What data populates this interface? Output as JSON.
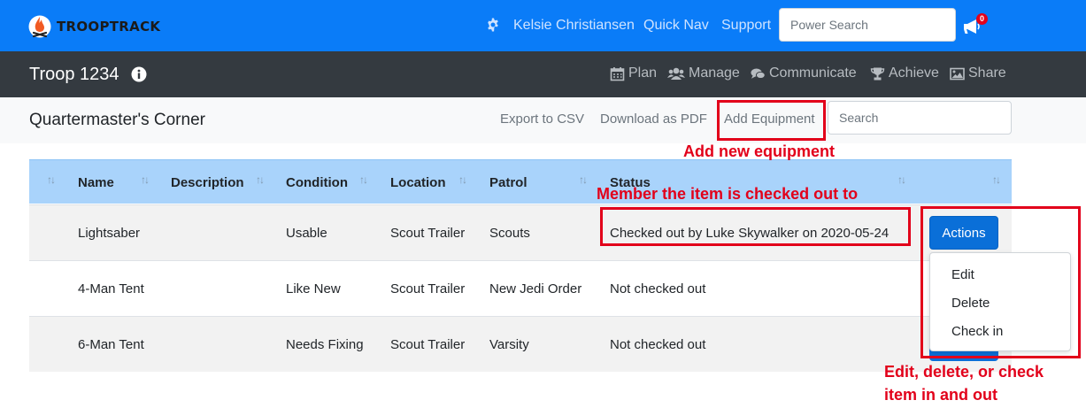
{
  "brand": {
    "name": "TROOPTRACK"
  },
  "topbar": {
    "user_name": "Kelsie Christiansen",
    "quick_nav": "Quick Nav",
    "support": "Support",
    "search_placeholder": "Power Search",
    "notification_count": "0",
    "bg_color": "#0a7cf8"
  },
  "troopbar": {
    "troop_name": "Troop 1234",
    "nav": [
      {
        "label": "Plan",
        "icon": "calendar-icon"
      },
      {
        "label": "Manage",
        "icon": "users-icon"
      },
      {
        "label": "Communicate",
        "icon": "comments-icon"
      },
      {
        "label": "Achieve",
        "icon": "trophy-icon"
      },
      {
        "label": "Share",
        "icon": "image-icon"
      }
    ]
  },
  "subbar": {
    "title": "Quartermaster's Corner",
    "export_csv": "Export to CSV",
    "download_pdf": "Download as PDF",
    "add_equipment": "Add Equipment",
    "search_placeholder": "Search"
  },
  "table": {
    "columns": [
      "",
      "Name",
      "Description",
      "Condition",
      "Location",
      "Patrol",
      "Status",
      ""
    ],
    "rows": [
      {
        "name": "Lightsaber",
        "description": "",
        "condition": "Usable",
        "location": "Scout Trailer",
        "patrol": "Scouts",
        "status": "Checked out by Luke Skywalker on 2020-05-24"
      },
      {
        "name": "4-Man Tent",
        "description": "",
        "condition": "Like New",
        "location": "Scout Trailer",
        "patrol": "New Jedi Order",
        "status": "Not checked out"
      },
      {
        "name": "6-Man Tent",
        "description": "",
        "condition": "Needs Fixing",
        "location": "Scout Trailer",
        "patrol": "Varsity",
        "status": "Not checked out"
      }
    ]
  },
  "actions": {
    "button_label": "Actions",
    "menu": [
      "Edit",
      "Delete",
      "Check in"
    ]
  },
  "annotations": {
    "add_new": "Add new equipment",
    "member": "Member the item is checked out to",
    "edit_line1": "Edit, delete, or check",
    "edit_line2": "item in and out",
    "color": "#e2001a"
  }
}
